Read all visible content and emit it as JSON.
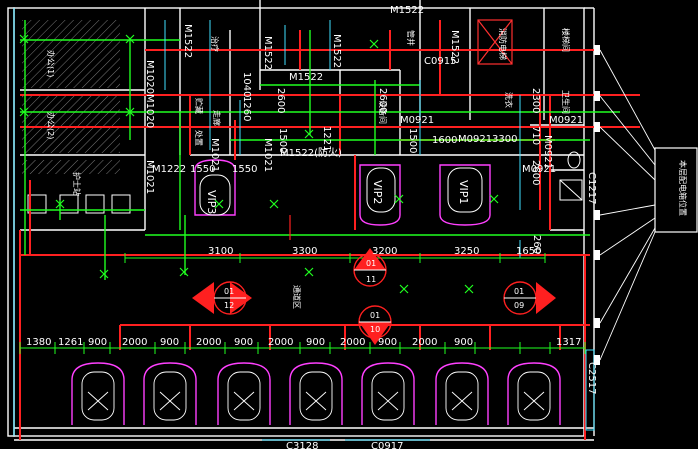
{
  "doors": {
    "m1522_top_left": "M1522",
    "m1522_top_mid": "M1522",
    "m1522_center": "M1522",
    "m1522_top_right": "M1522",
    "m1522_right": "M1522",
    "m1522_lower": "M1522(防火)",
    "m1020_a": "M1020",
    "m1020_b": "M1020",
    "m1021_a": "M1021",
    "m1021_b": "M1021",
    "m1222": "M1222",
    "m1040": "1040",
    "m1260": "1260",
    "m0921_a": "M0921",
    "m0921_b": "M0921",
    "m0921_c": "M0921",
    "m0921_d": "M0921",
    "m0921_e": "M0921",
    "m1221": "1221",
    "c0915": "C0915",
    "c1217": "C1217",
    "c2517": "C2517",
    "c3128": "C3128",
    "c0917": "C0917"
  },
  "dims_small": {
    "d2600_a": "2600",
    "d2600_b": "2600",
    "d2600_c": "2600",
    "d1500": "1500",
    "d1500_b": "1500",
    "d1550_a": "1550",
    "d1550_b": "1550",
    "d2300": "2300",
    "d710": "710",
    "d1600": "1600",
    "d3300_small": "3300",
    "d260": "260"
  },
  "dims_row1": [
    "3100",
    "3300",
    "3200",
    "3250",
    "1650"
  ],
  "dims_row2": [
    "1380",
    "1261",
    "900",
    "2000",
    "900",
    "2000",
    "900",
    "2000",
    "900",
    "2000",
    "900",
    "2000",
    "900",
    "1317"
  ],
  "rooms": {
    "office1": "办公(1)",
    "office2": "办公(2)",
    "nurse": "护士站",
    "vip1": "VIP1",
    "vip2": "VIP2",
    "vip3": "VIP3",
    "corridor": "通道区",
    "storage": "贮藏",
    "treatment": "处置",
    "prep": "治疗",
    "equipment": "设备间",
    "wash": "洗衣",
    "elevator": "消防电梯",
    "shaft": "管井",
    "toilet": "卫生间",
    "corridor2": "走廊",
    "stair": "楼梯间",
    "entry_label": "医护人员出入口"
  },
  "markers": {
    "m01_top_a": "01",
    "m11": "11",
    "m01_left": "01",
    "m12": "12",
    "m01_right": "01",
    "m09": "09",
    "m01_mid": "01",
    "m10": "10"
  },
  "legend_box": "本层配电箱位置"
}
